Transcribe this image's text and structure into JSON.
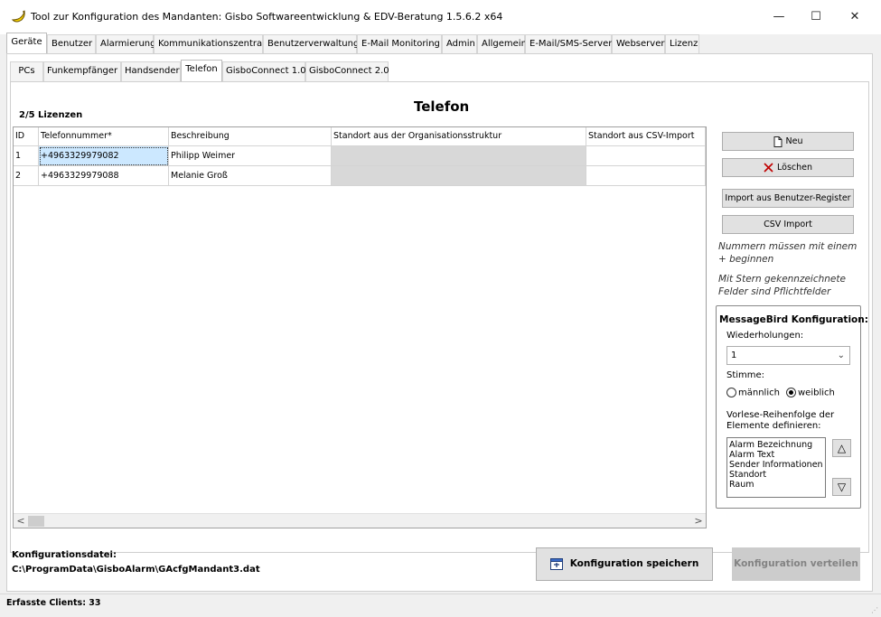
{
  "window": {
    "title": "Tool zur Konfiguration des Mandanten: Gisbo Softwareentwicklung & EDV-Beratung 1.5.6.2 x64",
    "minimize": "—",
    "maximize": "☐",
    "close": "✕"
  },
  "main_tabs": [
    {
      "label": "Geräte",
      "active": true
    },
    {
      "label": "Benutzer"
    },
    {
      "label": "Alarmierung"
    },
    {
      "label": "Kommunikationszentrale"
    },
    {
      "label": "Benutzerverwaltung"
    },
    {
      "label": "E-Mail Monitoring"
    },
    {
      "label": "Admin"
    },
    {
      "label": "Allgemein"
    },
    {
      "label": "E-Mail/SMS-Server"
    },
    {
      "label": "Webserver"
    },
    {
      "label": "Lizenz"
    }
  ],
  "sub_tabs": [
    {
      "label": "PCs"
    },
    {
      "label": "Funkempfänger"
    },
    {
      "label": "Handsender"
    },
    {
      "label": "Telefon",
      "active": true
    },
    {
      "label": "GisboConnect 1.0"
    },
    {
      "label": "GisboConnect 2.0"
    }
  ],
  "page": {
    "heading": "Telefon",
    "licenses": "2/5 Lizenzen"
  },
  "grid": {
    "columns": [
      "ID",
      "Telefonnummer*",
      "Beschreibung",
      "Standort aus der Organisationsstruktur",
      "Standort aus CSV-Import"
    ],
    "rows": [
      {
        "id": "1",
        "phone": "+4963329979082",
        "description": "Philipp Weimer",
        "org_location": "",
        "csv_location": ""
      },
      {
        "id": "2",
        "phone": "+4963329979088",
        "description": "Melanie Groß",
        "org_location": "",
        "csv_location": ""
      }
    ],
    "scroll_left": "<",
    "scroll_right": ">"
  },
  "side": {
    "new": "Neu",
    "delete": "Löschen",
    "import_user": "Import aus Benutzer-Register",
    "csv_import": "CSV Import",
    "hint_plus": "Nummern müssen mit einem + beginnen",
    "hint_required": "Mit Stern gekennzeichnete Felder sind Pflichtfelder"
  },
  "messagebird": {
    "title": "MessageBird Konfiguration:",
    "repeats_label": "Wiederholungen:",
    "repeats_value": "1",
    "voice_label": "Stimme:",
    "male": "männlich",
    "female": "weiblich",
    "selected_voice": "weiblich",
    "order_label_1": "Vorlese-Reihenfolge der",
    "order_label_2": "Elemente definieren:",
    "order_items": [
      "Alarm Bezeichnung",
      "Alarm Text",
      "Sender Informationen",
      "Standort",
      "Raum"
    ],
    "up": "△",
    "down": "▽"
  },
  "footer": {
    "config_label": "Konfigurationsdatei:",
    "config_path": "C:\\ProgramData\\GisboAlarm\\GAcfgMandant3.dat",
    "save_button": "Konfiguration speichern",
    "distribute_button": "Konfiguration verteilen"
  },
  "status": {
    "text": "Erfasste Clients: 33"
  },
  "colors": {
    "selection": "#cce8ff",
    "readonly_cell": "#d8d8d8",
    "delete_icon": "#c00000",
    "disabled_text": "#838383"
  },
  "icons": {
    "app": "banana-app-icon",
    "new": "document-icon",
    "delete": "x-icon",
    "save": "save-config-icon"
  }
}
